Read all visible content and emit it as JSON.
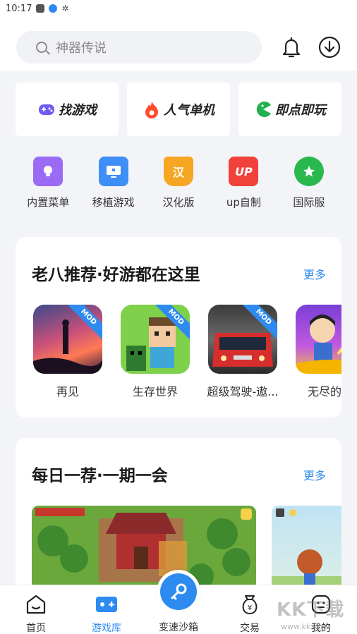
{
  "status_bar": {
    "time": "10:17"
  },
  "search": {
    "placeholder": "神器传说"
  },
  "quick_links": [
    {
      "label": "找游戏",
      "icon": "gamepad-icon",
      "color": "#6f5cf0"
    },
    {
      "label": "人气单机",
      "icon": "flame-icon",
      "color": "#ff4d2e"
    },
    {
      "label": "即点即玩",
      "icon": "pacman-icon",
      "color": "#22b14c"
    }
  ],
  "categories": [
    {
      "label": "内置菜单",
      "icon": "lightbulb-icon",
      "color": "#9a6cf5"
    },
    {
      "label": "移植游戏",
      "icon": "monitor-icon",
      "color": "#3e8ef7"
    },
    {
      "label": "汉化版",
      "icon": "han-icon",
      "glyph": "汉",
      "color": "#f5a623"
    },
    {
      "label": "up自制",
      "icon": "up-icon",
      "glyph": "UP",
      "color": "#f0413a"
    },
    {
      "label": "国际服",
      "icon": "planet-icon",
      "color": "#29b84e"
    }
  ],
  "section_recommend": {
    "title": "老八推荐·好游都在这里",
    "more": "更多",
    "games": [
      {
        "name": "再见",
        "badge": "MOD"
      },
      {
        "name": "生存世界",
        "badge": "MOD"
      },
      {
        "name": "超级驾驶-遨...",
        "badge": "MOD"
      },
      {
        "name": "无尽的生",
        "badge": ""
      }
    ]
  },
  "section_daily": {
    "title": "每日一荐·一期一会",
    "more": "更多"
  },
  "tabbar": {
    "home": "首页",
    "library": "游戏库",
    "sandbox": "变速沙箱",
    "trade": "交易",
    "mine": "我的"
  },
  "watermark": {
    "main": "KK下载",
    "sub": "www.kkx.net"
  },
  "colors": {
    "accent": "#2d8bf0",
    "background": "#f3f4f7"
  }
}
